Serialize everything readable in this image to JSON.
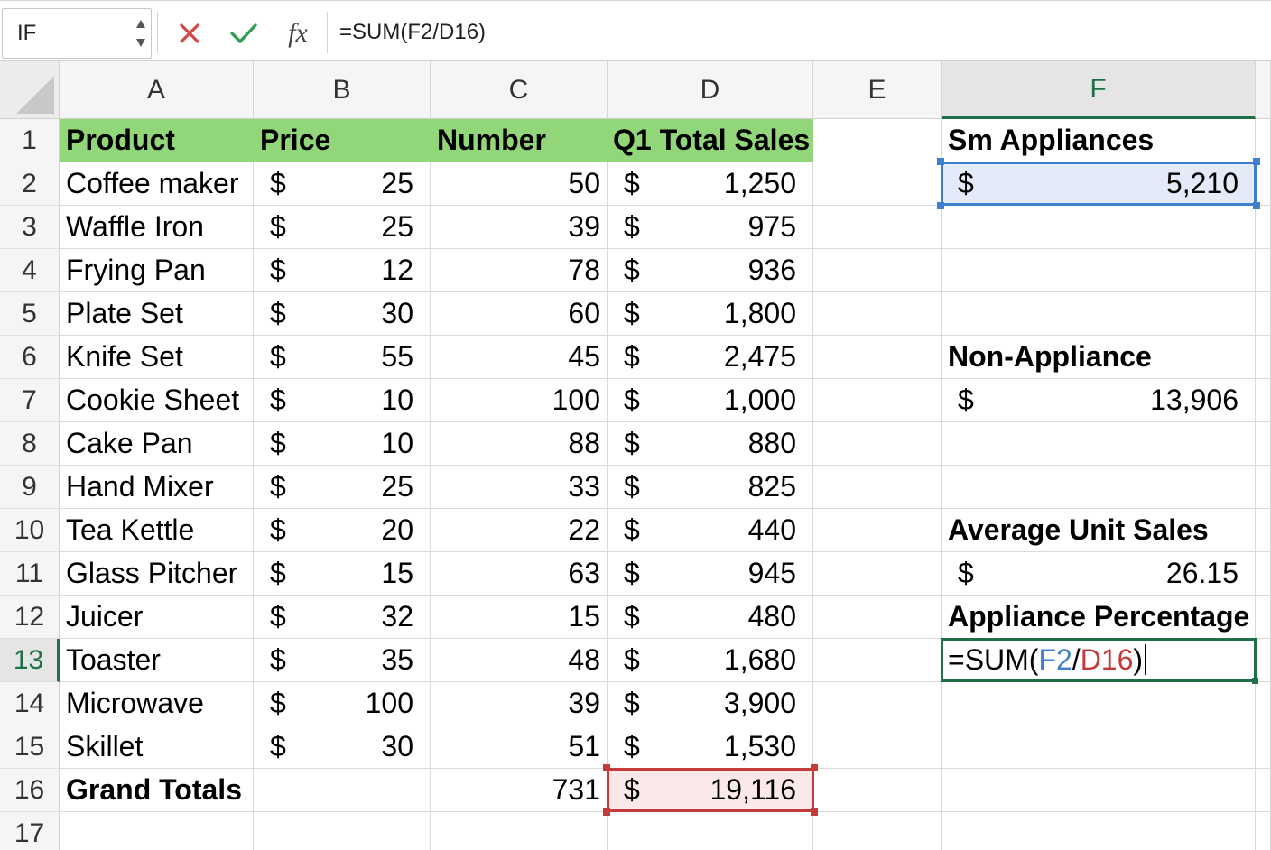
{
  "formula_bar": {
    "name_box": "IF",
    "cancel_icon": "close-icon",
    "enter_icon": "checkmark-icon",
    "fx_label": "fx",
    "formula": "=SUM(F2/D16)"
  },
  "columns": [
    "A",
    "B",
    "C",
    "D",
    "E",
    "F"
  ],
  "active_column": "F",
  "active_row": "13",
  "rows": [
    "1",
    "2",
    "3",
    "4",
    "5",
    "6",
    "7",
    "8",
    "9",
    "10",
    "11",
    "12",
    "13",
    "14",
    "15",
    "16",
    "17"
  ],
  "table": {
    "headers": {
      "product": "Product",
      "price": "Price",
      "number": "Number",
      "sales": "Q1 Total Sales"
    },
    "currency": "$",
    "items": [
      {
        "product": "Coffee maker",
        "price": "25",
        "number": "50",
        "sales": "1,250"
      },
      {
        "product": "Waffle Iron",
        "price": "25",
        "number": "39",
        "sales": "975"
      },
      {
        "product": "Frying Pan",
        "price": "12",
        "number": "78",
        "sales": "936"
      },
      {
        "product": "Plate Set",
        "price": "30",
        "number": "60",
        "sales": "1,800"
      },
      {
        "product": "Knife Set",
        "price": "55",
        "number": "45",
        "sales": "2,475"
      },
      {
        "product": "Cookie Sheet",
        "price": "10",
        "number": "100",
        "sales": "1,000"
      },
      {
        "product": "Cake Pan",
        "price": "10",
        "number": "88",
        "sales": "880"
      },
      {
        "product": "Hand Mixer",
        "price": "25",
        "number": "33",
        "sales": "825"
      },
      {
        "product": "Tea Kettle",
        "price": "20",
        "number": "22",
        "sales": "440"
      },
      {
        "product": "Glass Pitcher",
        "price": "15",
        "number": "63",
        "sales": "945"
      },
      {
        "product": "Juicer",
        "price": "32",
        "number": "15",
        "sales": "480"
      },
      {
        "product": "Toaster",
        "price": "35",
        "number": "48",
        "sales": "1,680"
      },
      {
        "product": "Microwave",
        "price": "100",
        "number": "39",
        "sales": "3,900"
      },
      {
        "product": "Skillet",
        "price": "30",
        "number": "51",
        "sales": "1,530"
      }
    ],
    "totals": {
      "label": "Grand Totals",
      "number": "731",
      "sales": "19,116"
    }
  },
  "summary": {
    "sm_appliances_label": "Sm Appliances",
    "sm_appliances_value": "5,210",
    "non_appliance_label": "Non-Appliance",
    "non_appliance_value": "13,906",
    "avg_unit_sales_label": "Average Unit Sales",
    "avg_unit_sales_value": "26.15",
    "appliance_pct_label": "Appliance Percentage",
    "appliance_pct_edit": {
      "part1": "=SUM(",
      "ref1": "F2",
      "slash": "/",
      "ref2": "D16",
      "part2": ")"
    }
  },
  "colors": {
    "header_fill": "#92d67a",
    "active_green": "#1e7145",
    "ref_blue": "#3f7fd0",
    "ref_red": "#c43b3b",
    "cancel_red": "#d64545",
    "enter_green": "#2e9e4f"
  }
}
